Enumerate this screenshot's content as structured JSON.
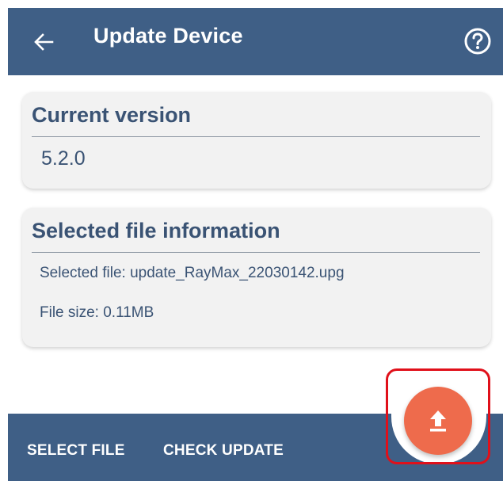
{
  "header": {
    "title": "Update Device",
    "back_icon": "back-arrow-icon",
    "help_icon": "help-circle-icon",
    "color": "#3f5f86"
  },
  "current_version": {
    "title": "Current version",
    "value": "5.2.0"
  },
  "file_info": {
    "title": "Selected file information",
    "selected_file": "Selected file: update_RayMax_22030142.upg",
    "file_size": "File size: 0.11MB"
  },
  "bottom_bar": {
    "select_file_label": "SELECT FILE",
    "check_update_label": "CHECK UPDATE"
  },
  "fab": {
    "icon": "upload-icon",
    "color": "#ee6b4c"
  },
  "highlight_color": "#e0101a"
}
